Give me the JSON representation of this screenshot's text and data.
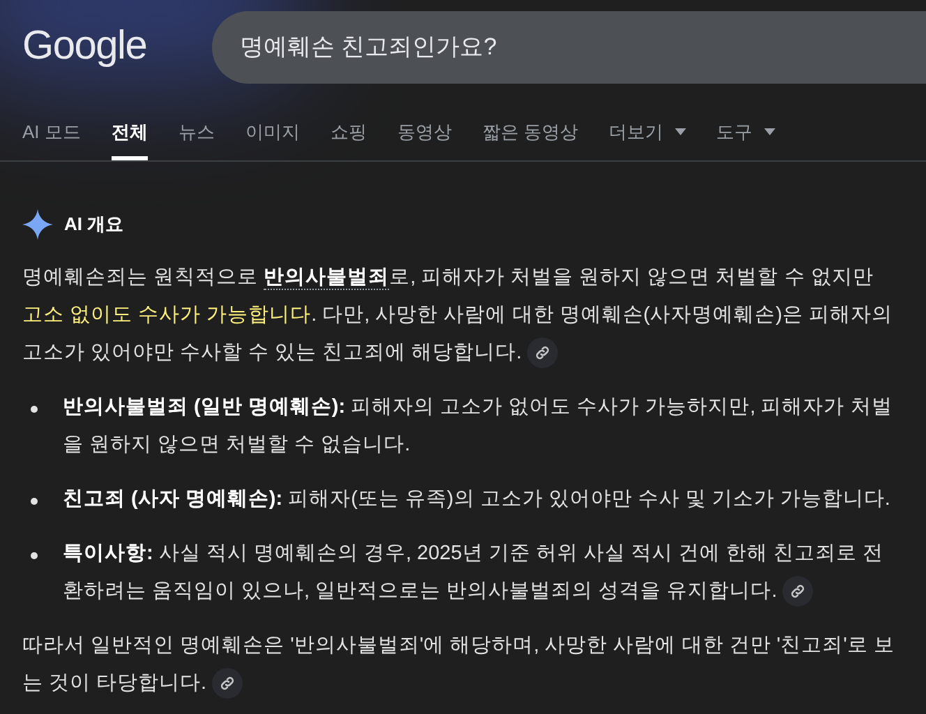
{
  "logo": "Google",
  "search": {
    "value": "명예훼손 친고죄인가요?"
  },
  "tabs": [
    {
      "label": "AI 모드",
      "selected": false,
      "dropdown": false
    },
    {
      "label": "전체",
      "selected": true,
      "dropdown": false
    },
    {
      "label": "뉴스",
      "selected": false,
      "dropdown": false
    },
    {
      "label": "이미지",
      "selected": false,
      "dropdown": false
    },
    {
      "label": "쇼핑",
      "selected": false,
      "dropdown": false
    },
    {
      "label": "동영상",
      "selected": false,
      "dropdown": false
    },
    {
      "label": "짧은 동영상",
      "selected": false,
      "dropdown": false
    },
    {
      "label": "더보기",
      "selected": false,
      "dropdown": true
    },
    {
      "label": "도구",
      "selected": false,
      "dropdown": true
    }
  ],
  "ai_overview": {
    "title": "AI 개요",
    "intro": [
      {
        "kind": "plain",
        "text": "명예훼손죄는 원칙적으로 "
      },
      {
        "kind": "term",
        "text": "반의사불벌죄"
      },
      {
        "kind": "plain",
        "text": "로, 피해자가 처벌을 원하지 않으면 처벌할 수 없지만 "
      },
      {
        "kind": "highlight",
        "text": "고소 없이도 수사가 가능합니다"
      },
      {
        "kind": "plain",
        "text": ". 다만, 사망한 사람에 대한 명예훼손(사자명예훼손)은 피해자의 고소가 있어야만 수사할 수 있는 친고죄에 해당합니다."
      }
    ],
    "intro_link": true,
    "bullets": [
      {
        "text": "**반의사불벌죄 (일반 명예훼손):** 피해자의 고소가 없어도 수사가 가능하지만, 피해자가 처벌을 원하지 않으면 처벌할 수 없습니다.",
        "link": false
      },
      {
        "text": "**친고죄 (사자 명예훼손):** 피해자(또는 유족)의 고소가 있어야만 수사 및 기소가 가능합니다.",
        "link": false
      },
      {
        "text": "**특이사항:** 사실 적시 명예훼손의 경우, 2025년 기준 허위 사실 적시 건에 한해 친고죄로 전환하려는 움직임이 있으나, 일반적으로는 반의사불벌죄의 성격을 유지합니다.",
        "link": true
      }
    ],
    "conclusion": "따라서 일반적인 명예훼손은 '반의사불벌죄'에 해당하며, 사망한 사람에 대한 건만 '친고죄'로 보는 것이 타당합니다.",
    "conclusion_link": true
  }
}
